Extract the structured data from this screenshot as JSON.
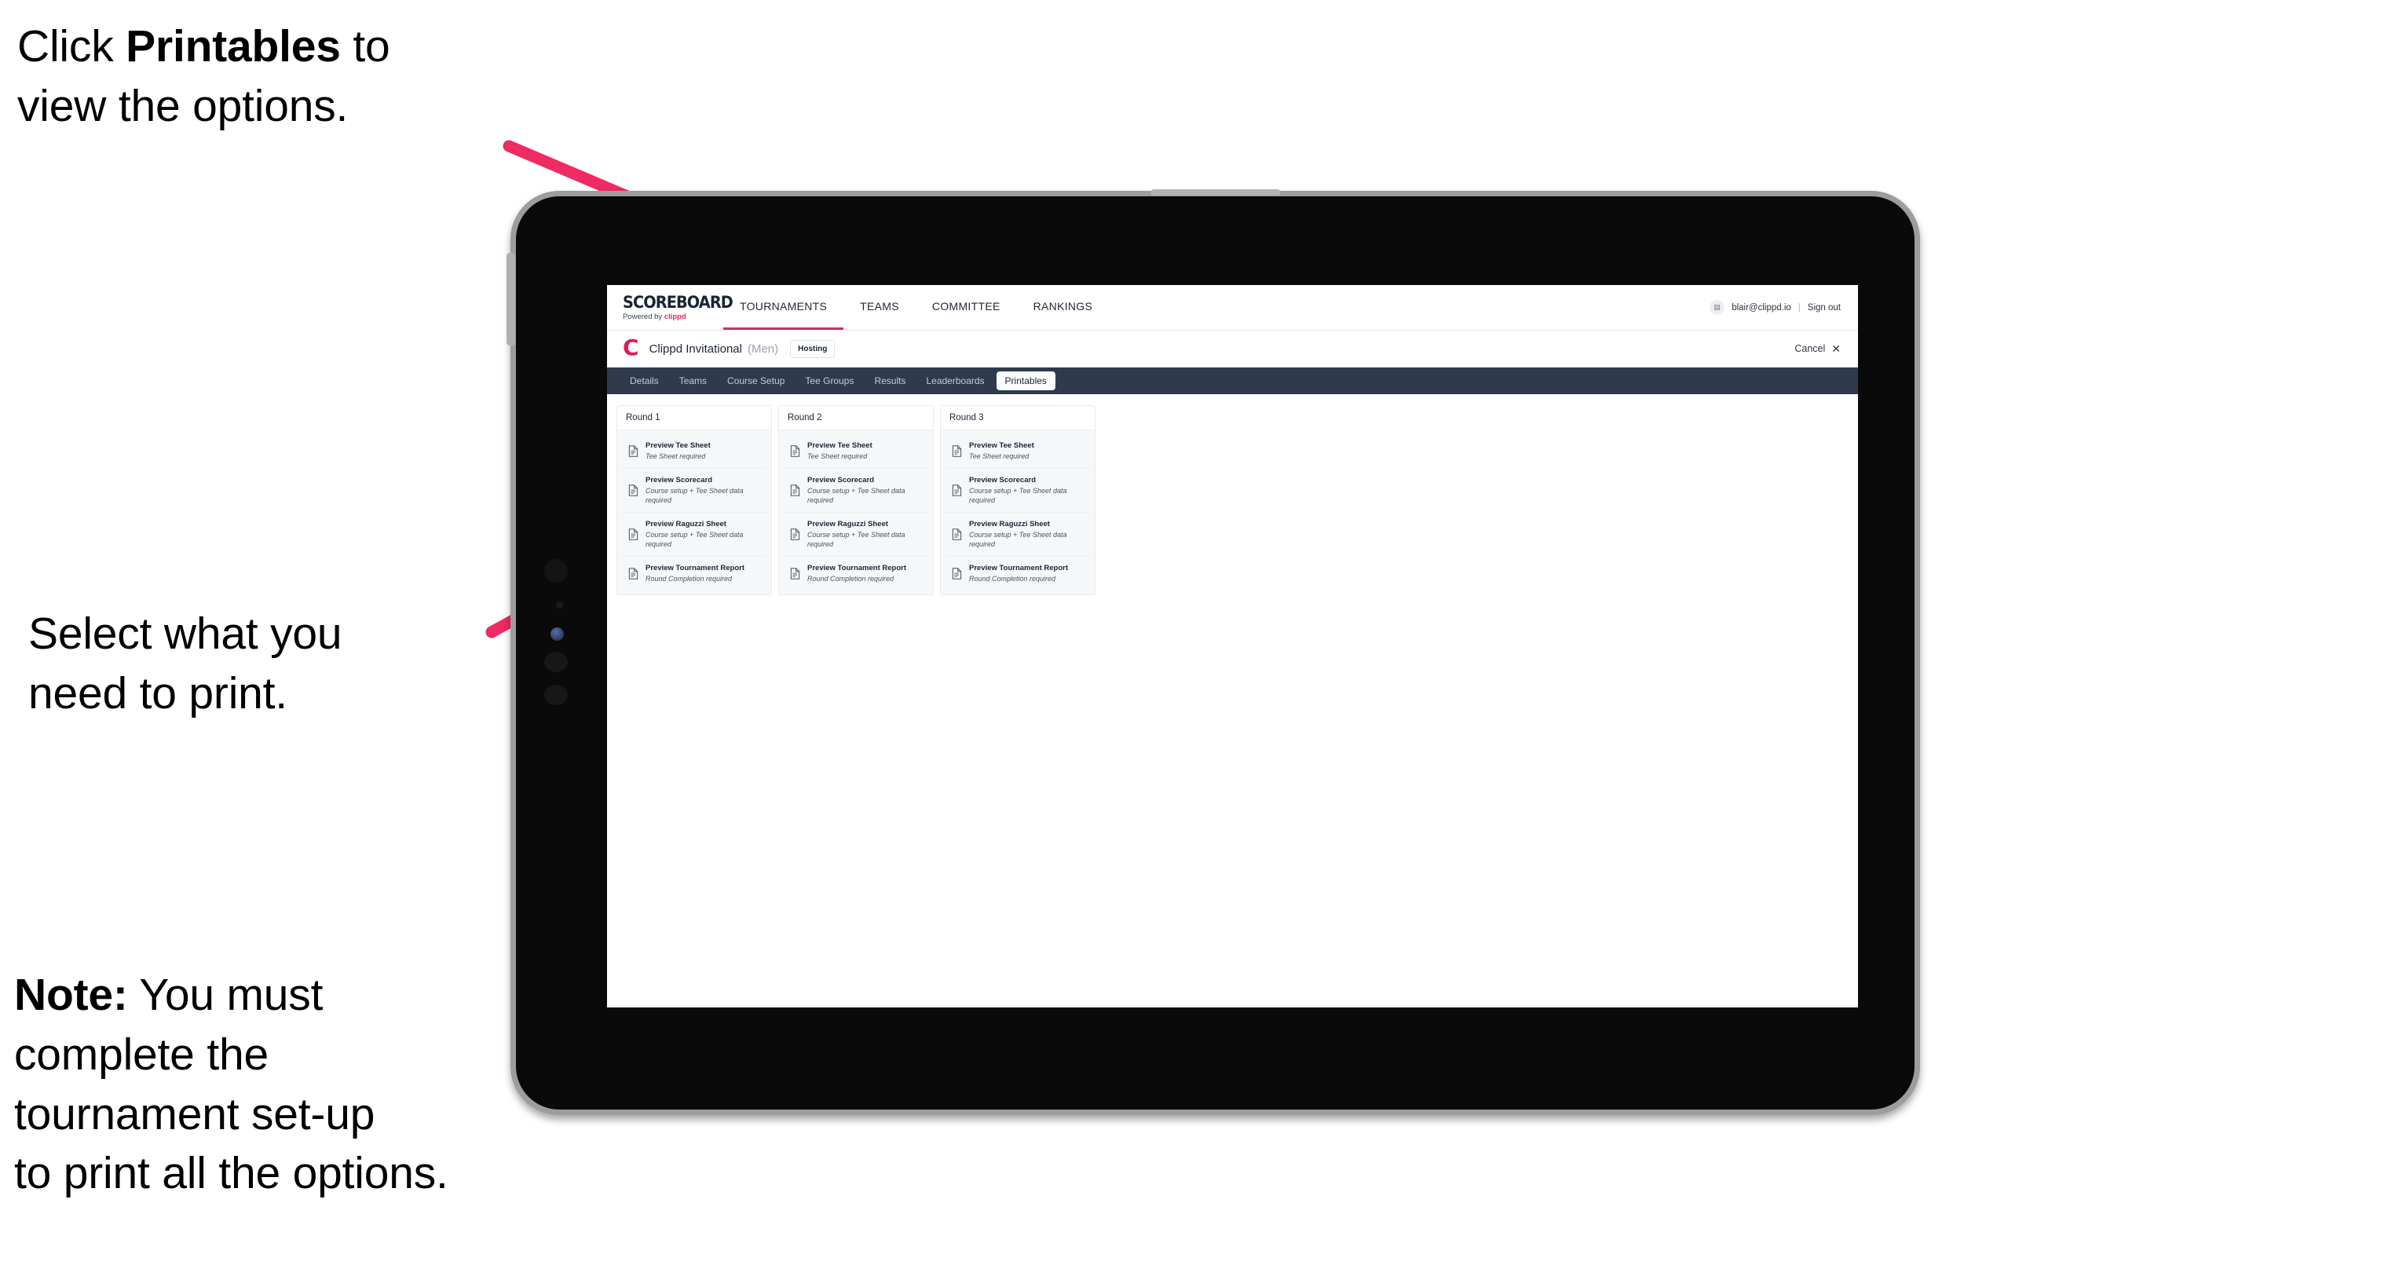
{
  "annotations": {
    "top": {
      "before": "Click ",
      "bold": "Printables",
      "after": " to\nview the options."
    },
    "middle": {
      "text": "Select what you\n need to print."
    },
    "note": {
      "bold": "Note:",
      "after": " You must\ncomplete the\ntournament set-up\nto print all the options."
    }
  },
  "accent": {
    "arrow_pink": "#F02A63",
    "brand_pink": "#E01A52",
    "navy": "#2F3A4D"
  },
  "app": {
    "logo": {
      "word": "SCOREBOARD",
      "sub_prefix": "Powered by ",
      "sub_brand": "clippd"
    },
    "nav": [
      {
        "label": "TOURNAMENTS",
        "active": true
      },
      {
        "label": "TEAMS",
        "active": false
      },
      {
        "label": "COMMITTEE",
        "active": false
      },
      {
        "label": "RANKINGS",
        "active": false
      }
    ],
    "account": {
      "avatar_glyph": "▤",
      "email": "blair@clippd.io",
      "separator": "|",
      "signout": "Sign out"
    },
    "tournament": {
      "mark": "C",
      "title": "Clippd Invitational",
      "gender": "(Men)",
      "badge": "Hosting",
      "cancel_label": "Cancel",
      "cancel_icon": "✕"
    },
    "subnav": [
      {
        "label": "Details",
        "active": false
      },
      {
        "label": "Teams",
        "active": false
      },
      {
        "label": "Course Setup",
        "active": false
      },
      {
        "label": "Tee Groups",
        "active": false
      },
      {
        "label": "Results",
        "active": false
      },
      {
        "label": "Leaderboards",
        "active": false
      },
      {
        "label": "Printables",
        "active": true
      }
    ],
    "rounds": [
      {
        "header": "Round 1",
        "items": [
          {
            "title": "Preview Tee Sheet",
            "subtitle": "Tee Sheet required"
          },
          {
            "title": "Preview Scorecard",
            "subtitle": "Course setup + Tee Sheet data required"
          },
          {
            "title": "Preview Raguzzi Sheet",
            "subtitle": "Course setup + Tee Sheet data required"
          },
          {
            "title": "Preview Tournament Report",
            "subtitle": "Round Completion required"
          }
        ]
      },
      {
        "header": "Round 2",
        "items": [
          {
            "title": "Preview Tee Sheet",
            "subtitle": "Tee Sheet required"
          },
          {
            "title": "Preview Scorecard",
            "subtitle": "Course setup + Tee Sheet data required"
          },
          {
            "title": "Preview Raguzzi Sheet",
            "subtitle": "Course setup + Tee Sheet data required"
          },
          {
            "title": "Preview Tournament Report",
            "subtitle": "Round Completion required"
          }
        ]
      },
      {
        "header": "Round 3",
        "items": [
          {
            "title": "Preview Tee Sheet",
            "subtitle": "Tee Sheet required"
          },
          {
            "title": "Preview Scorecard",
            "subtitle": "Course setup + Tee Sheet data required"
          },
          {
            "title": "Preview Raguzzi Sheet",
            "subtitle": "Course setup + Tee Sheet data required"
          },
          {
            "title": "Preview Tournament Report",
            "subtitle": "Round Completion required"
          }
        ]
      }
    ]
  }
}
